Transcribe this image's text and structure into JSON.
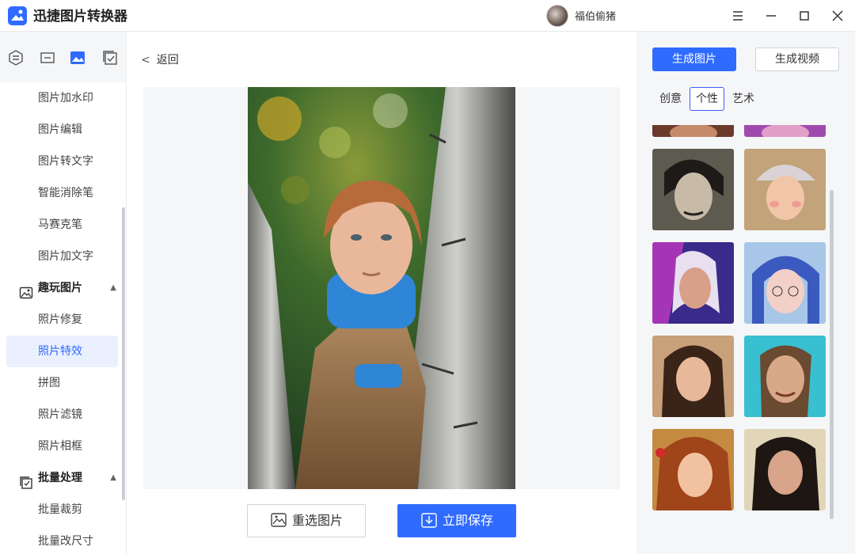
{
  "app": {
    "title": "迅捷图片转换器",
    "username": "福伯偷猪"
  },
  "window": {
    "menu_icon": "hamburger-icon",
    "min_icon": "minimize-icon",
    "max_icon": "maximize-icon",
    "close_icon": "close-icon"
  },
  "sidebar": {
    "tab_icons": [
      "convert-icon",
      "resize-icon",
      "image-icon",
      "batch-icon"
    ],
    "items": [
      {
        "label": "图片加水印"
      },
      {
        "label": "图片编辑"
      },
      {
        "label": "图片转文字"
      },
      {
        "label": "智能消除笔"
      },
      {
        "label": "马赛克笔"
      },
      {
        "label": "图片加文字"
      }
    ],
    "group_fun": {
      "label": "趣玩图片",
      "icon": "fun-image-icon"
    },
    "fun_items": [
      {
        "label": "照片修复"
      },
      {
        "label": "照片特效",
        "active": true
      },
      {
        "label": "拼图"
      },
      {
        "label": "照片滤镜"
      },
      {
        "label": "照片相框"
      }
    ],
    "group_batch": {
      "label": "批量处理",
      "icon": "batch-check-icon"
    },
    "batch_items": [
      {
        "label": "批量裁剪"
      },
      {
        "label": "批量改尺寸"
      }
    ]
  },
  "center": {
    "back_label": "返回",
    "reselect_label": "重选图片",
    "save_label": "立即保存"
  },
  "right": {
    "gen_image_label": "生成图片",
    "gen_video_label": "生成视频",
    "subtabs": [
      {
        "label": "创意"
      },
      {
        "label": "个性",
        "active": true
      },
      {
        "label": "艺术"
      }
    ]
  },
  "colors": {
    "accent": "#2f6bff",
    "active_bg": "#eaf0fd",
    "panel_bg": "#f5f6f8"
  }
}
